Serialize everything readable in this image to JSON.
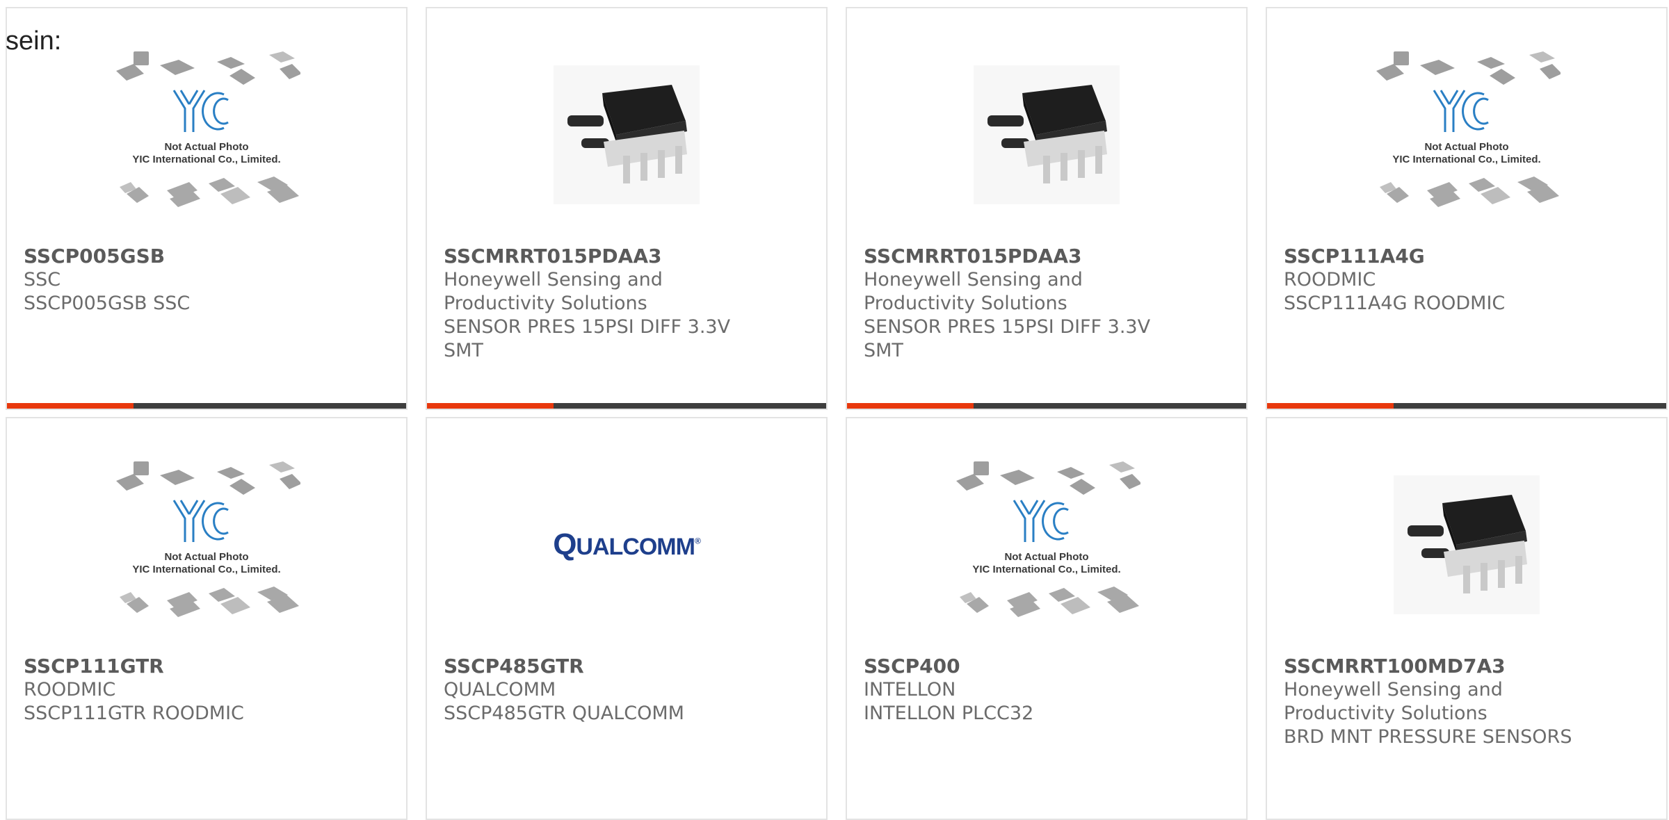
{
  "lead_text": "sein:",
  "placeholder_caption": {
    "line1": "Not Actual Photo",
    "line2": "YIC International Co., Limited."
  },
  "qualcomm_logo": {
    "big_q": "Q",
    "rest": "UALCOMM",
    "mark": "®"
  },
  "accent_colors": {
    "bar_red": "#e8380d",
    "bar_dark": "#3e3e3e",
    "yic_blue": "#2a7fc4"
  },
  "products": [
    {
      "part": "SSCP005GSB",
      "lines": [
        "SSC",
        "SSCP005GSB SSC"
      ],
      "image": "yic-placeholder"
    },
    {
      "part": "SSCMRRT015PDAA3",
      "lines": [
        "Honeywell Sensing and",
        "Productivity Solutions",
        "SENSOR PRES 15PSI DIFF 3.3V",
        "SMT"
      ],
      "image": "pressure-sensor-photo"
    },
    {
      "part": "SSCMRRT015PDAA3",
      "lines": [
        "Honeywell Sensing and",
        "Productivity Solutions",
        "SENSOR PRES 15PSI DIFF 3.3V",
        "SMT"
      ],
      "image": "pressure-sensor-photo"
    },
    {
      "part": "SSCP111A4G",
      "lines": [
        "ROODMIC",
        "SSCP111A4G ROODMIC"
      ],
      "image": "yic-placeholder"
    },
    {
      "part": "SSCP111GTR",
      "lines": [
        "ROODMIC",
        "SSCP111GTR ROODMIC"
      ],
      "image": "yic-placeholder"
    },
    {
      "part": "SSCP485GTR",
      "lines": [
        "QUALCOMM",
        "SSCP485GTR QUALCOMM"
      ],
      "image": "qualcomm-logo"
    },
    {
      "part": "SSCP400",
      "lines": [
        "INTELLON",
        "INTELLON PLCC32"
      ],
      "image": "yic-placeholder"
    },
    {
      "part": "SSCMRRT100MD7A3",
      "lines": [
        "Honeywell Sensing and",
        "Productivity Solutions",
        "BRD MNT PRESSURE SENSORS"
      ],
      "image": "pressure-sensor-photo"
    }
  ]
}
